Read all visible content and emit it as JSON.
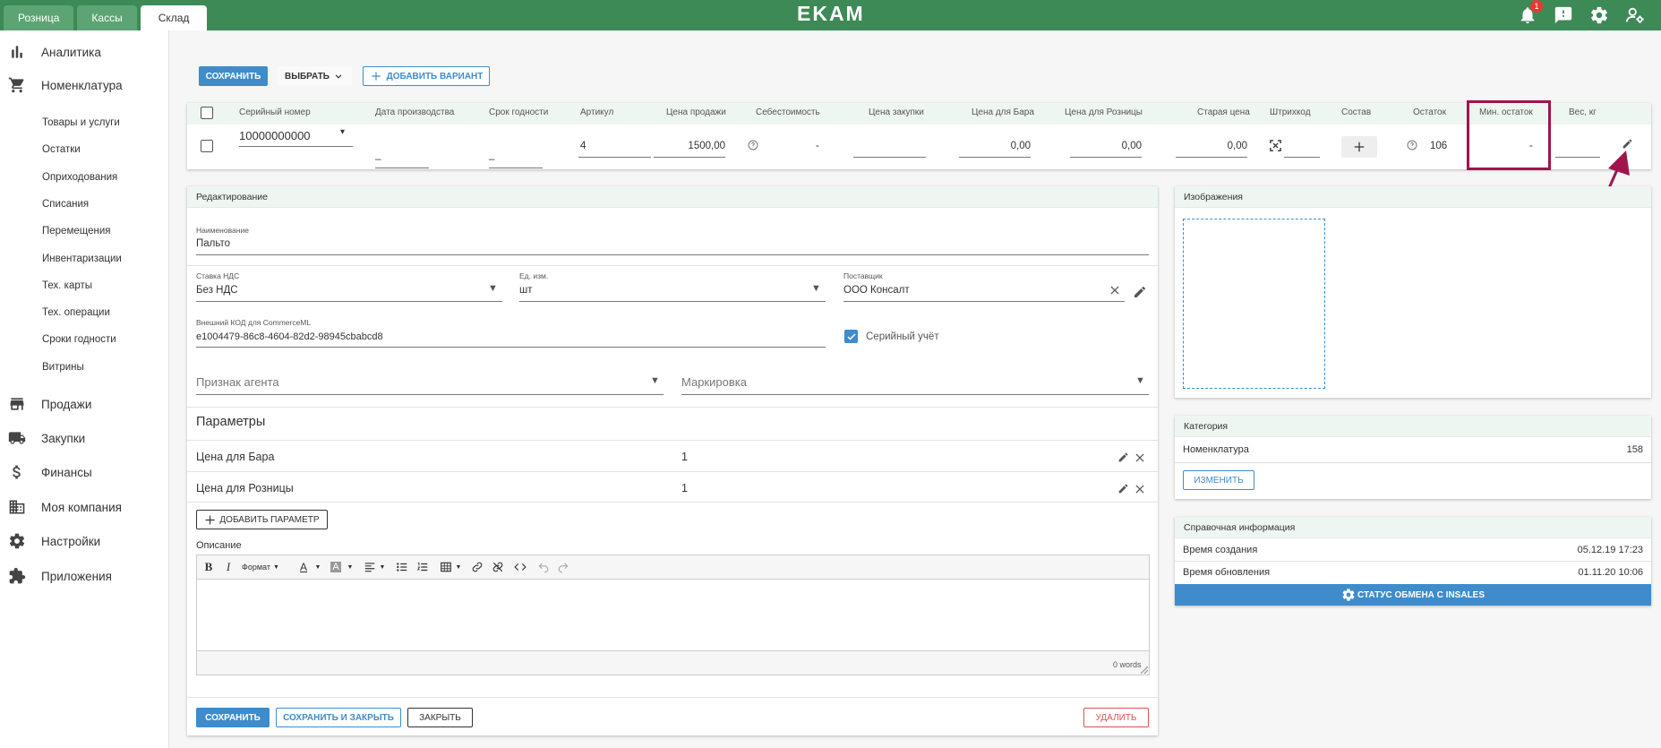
{
  "topbar": {
    "tabs": [
      "Розница",
      "Кассы",
      "Склад"
    ],
    "logo": "EKAM",
    "notif_count": "1",
    "colors": {
      "bar": "#3d8a57",
      "accent": "#3e8ccc",
      "highlight": "#a0144b"
    }
  },
  "sidebar": {
    "main": [
      "Аналитика",
      "Номенклатура",
      "Продажи",
      "Закупки",
      "Финансы",
      "Моя компания",
      "Настройки",
      "Приложения"
    ],
    "sub": [
      "Товары и услуги",
      "Остатки",
      "Оприходования",
      "Списания",
      "Перемещения",
      "Инвентаризации",
      "Тех. карты",
      "Тех. операции",
      "Сроки годности",
      "Витрины"
    ]
  },
  "toolbar": {
    "save": "СОХРАНИТЬ",
    "choose": "ВЫБРАТЬ",
    "add_variant": "ДОБАВИТЬ ВАРИАНТ"
  },
  "table": {
    "headers": [
      "Серийный номер",
      "Дата производства",
      "Срок годности",
      "Артикул",
      "Цена продажи",
      "Себестоимость",
      "Цена закупки",
      "Цена для Бара",
      "Цена для Розницы",
      "Старая цена",
      "Штрихкод",
      "Состав",
      "Остаток",
      "Мин. остаток",
      "Вес, кг"
    ],
    "row": {
      "serial": "10000000000",
      "prod_date": "_",
      "expiry": "_",
      "article": "4",
      "sale_price": "1500,00",
      "cost": "-",
      "bar_price": "0,00",
      "retail_price": "0,00",
      "old_price": "0,00",
      "stock": "106",
      "min_stock": "-"
    }
  },
  "edit": {
    "title": "Редактирование",
    "name_label": "Наименование",
    "name_value": "Пальто",
    "vat_label": "Ставка НДС",
    "vat_value": "Без НДС",
    "unit_label": "Ед. изм.",
    "unit_value": "шт",
    "supplier_label": "Поставщик",
    "supplier_value": "ООО Консалт",
    "ext_code_label": "Внешний КОД для CommerceML",
    "ext_code_value": "e1004479-86c8-4604-82d2-98945cbabcd8",
    "serial_accounting": "Серийный учёт",
    "agent_sign": "Признак агента",
    "marking": "Маркировка",
    "params_title": "Параметры",
    "params": [
      {
        "name": "Цена для Бара",
        "value": "1"
      },
      {
        "name": "Цена для Розницы",
        "value": "1"
      }
    ],
    "add_param": "ДОБАВИТЬ ПАРАМЕТР",
    "description_label": "Описание",
    "format_label": "Формат",
    "words": "0 words",
    "save": "СОХРАНИТЬ",
    "save_close": "СОХРАНИТЬ И ЗАКРЫТЬ",
    "close": "ЗАКРЫТЬ",
    "delete": "УДАЛИТЬ"
  },
  "images": {
    "title": "Изображения"
  },
  "category": {
    "title": "Категория",
    "name": "Номенклатура",
    "count": "158",
    "change": "ИЗМЕНИТЬ"
  },
  "info": {
    "title": "Справочная информация",
    "created_label": "Время создания",
    "created_value": "05.12.19 17:23",
    "updated_label": "Время обновления",
    "updated_value": "01.11.20 10:06",
    "exchange_status": "СТАТУС ОБМЕНА С INSALES"
  }
}
